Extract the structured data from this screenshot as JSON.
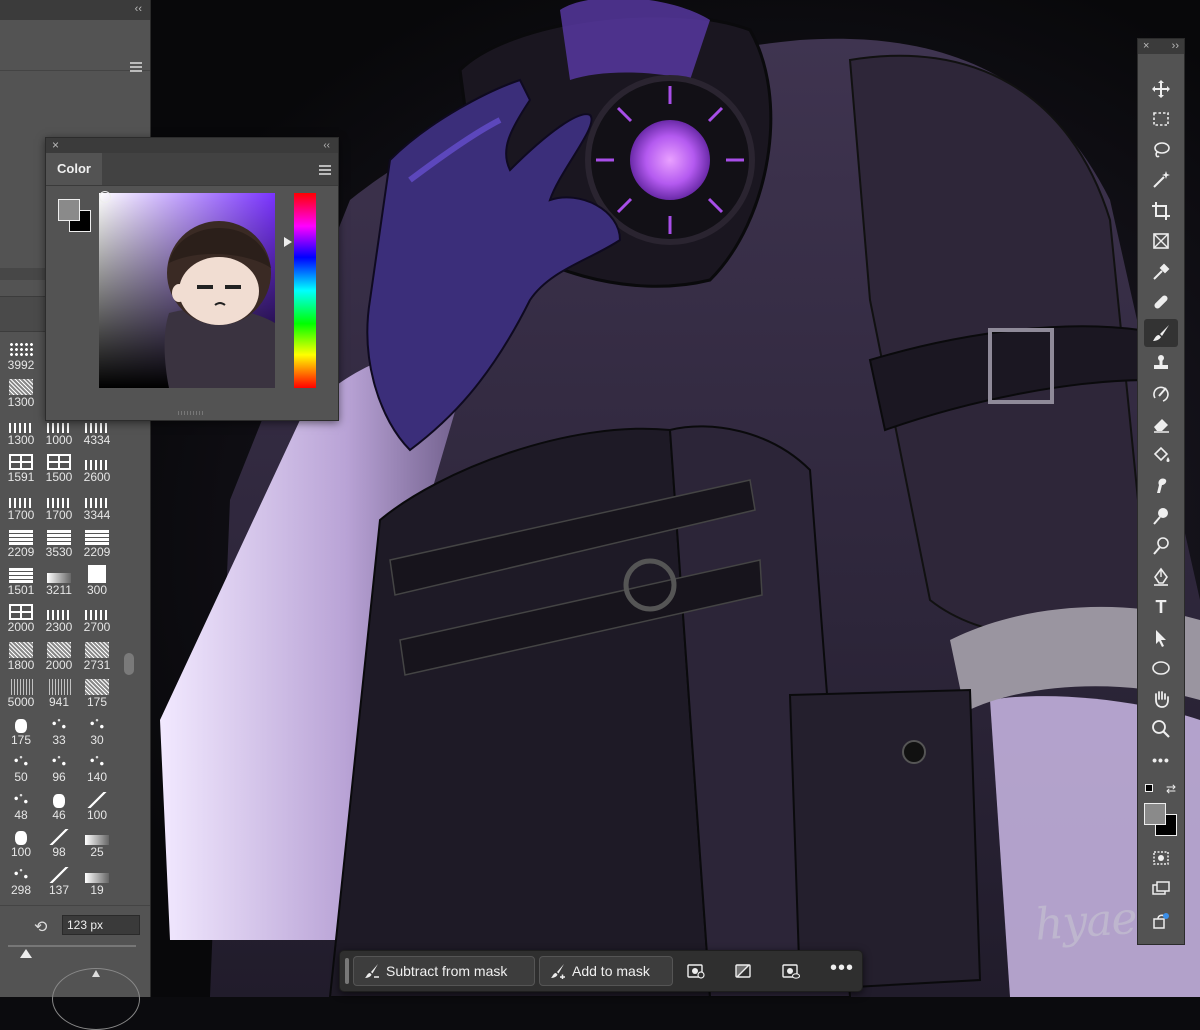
{
  "brushes_panel": {
    "brush_sizes": [
      "3992",
      "",
      "",
      "1300",
      "",
      "",
      "1300",
      "1000",
      "4334",
      "1591",
      "1500",
      "2600",
      "1700",
      "1700",
      "3344",
      "2209",
      "3530",
      "2209",
      "1501",
      "3211",
      "300",
      "2000",
      "2300",
      "2700",
      "1800",
      "2000",
      "2731",
      "5000",
      "941",
      "175",
      "175",
      "33",
      "30",
      "50",
      "96",
      "140",
      "48",
      "46",
      "100",
      "100",
      "98",
      "25",
      "298",
      "137",
      "19"
    ],
    "size_value": "123 px",
    "icons": {
      "reset": "reset-angle-icon"
    }
  },
  "color_panel": {
    "tab_label": "Color",
    "foreground_color": "#8a8a8a",
    "background_color": "#000000",
    "hue_color": "#7a33ff"
  },
  "toolbar": {
    "tools": [
      "move",
      "marquee",
      "lasso",
      "magic-wand",
      "crop",
      "frame",
      "eyedropper",
      "spot-healing",
      "brush",
      "clone-stamp",
      "history-brush",
      "eraser",
      "paint-bucket",
      "smudge",
      "dodge",
      "sponge",
      "pen",
      "type",
      "path-selection",
      "ellipse",
      "hand",
      "zoom",
      "more"
    ],
    "active_tool": "brush"
  },
  "task_bar": {
    "subtract_label": "Subtract from mask",
    "add_label": "Add to mask",
    "more_label": "•••"
  },
  "canvas": {
    "signature_text": "hyaeci"
  }
}
